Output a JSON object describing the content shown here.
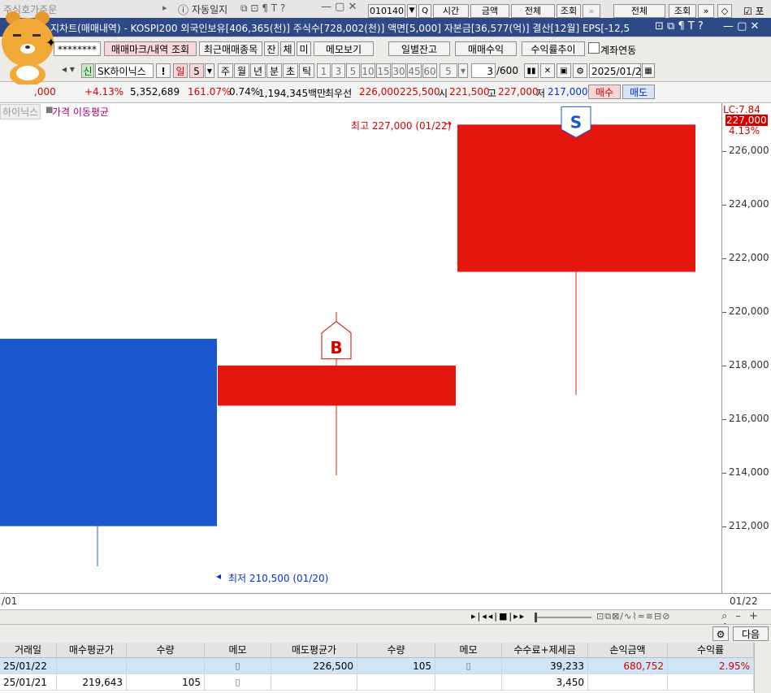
{
  "window": {
    "left_title": "주식호가주문",
    "auto_diary": "자동일지",
    "right_code": "010140",
    "right_opt1": "시간",
    "right_opt2": "금액",
    "right_opt3": "전체",
    "right_query": "조회",
    "right_opt4": "전체",
    "right_query2": "조회",
    "right_check": "포"
  },
  "chart_title": "지차트(매매내역) - KOSPI200 외국인보유[406,365(천)] 주식수[728,002(천)] 액면[5,000] 자본금[36,577(억)] 결산[12월] EPS[-12,5",
  "toolbar1": {
    "password": "********",
    "btn_markings": "매매마크/내역 조회",
    "btn_recent": "최근매매종목",
    "btn_jan": "잔",
    "btn_che": "체",
    "btn_mi": "미",
    "btn_memo": "메모보기",
    "btn_daily": "일별잔고",
    "btn_profit": "매매수익",
    "btn_trend": "수익률추이",
    "chk_account": "계좌연동"
  },
  "toolbar2": {
    "badge": "신",
    "stock_name": "SK하이닉스",
    "excl": "!",
    "period_selected": "일",
    "period_num": "5",
    "periods": [
      "주",
      "월",
      "년",
      "분",
      "초",
      "틱"
    ],
    "nums": [
      "1",
      "3",
      "5",
      "10",
      "15",
      "30",
      "45",
      "60"
    ],
    "num_sel": "5",
    "count": "3",
    "max_count": "/600",
    "date": "2025/01/22"
  },
  "quote": {
    "price": ",000",
    "change_pct": "+4.13%",
    "volume": "5,352,689",
    "vol_ratio": "161.07%",
    "turnover": "0.74%",
    "amount": "1,194,345백만",
    "priority_label": "최우선",
    "ask": "226,000",
    "bid": "225,500",
    "open_label": "시",
    "open": "221,500",
    "high_label": "고",
    "high": "227,000",
    "low_label": "저",
    "low": "217,000",
    "buy_btn": "매수",
    "sell_btn": "매도"
  },
  "legend": {
    "stock": "하이닉스",
    "ma": "가격 이동평균"
  },
  "annotations": {
    "high": "최고 227,000 (01/22)",
    "low": "최저 210,500 (01/20)",
    "sell_mark": "S",
    "buy_mark": "B"
  },
  "yaxis_top": {
    "lc": "LC:7.84",
    "last": "227,000",
    "pct": "4.13%"
  },
  "xaxis": {
    "left": "/01",
    "right": "01/22"
  },
  "tablebar": {
    "next": "다음"
  },
  "table": {
    "headers": [
      "거래일",
      "매수평균가",
      "수량",
      "메모",
      "매도평균가",
      "수량",
      "메모",
      "수수료+제세금",
      "손익금액",
      "수익률"
    ],
    "rows": [
      {
        "date": "25/01/22",
        "buy_avg": "",
        "buy_qty": "",
        "sell_avg": "226,500",
        "sell_qty": "105",
        "fee": "39,233",
        "pnl": "680,752",
        "rate": "2.95%"
      },
      {
        "date": "25/01/21",
        "buy_avg": "219,643",
        "buy_qty": "105",
        "sell_avg": "",
        "sell_qty": "",
        "fee": "3,450",
        "pnl": "",
        "rate": ""
      }
    ]
  },
  "chart_data": {
    "type": "candlestick",
    "ylim": [
      209500,
      227800
    ],
    "y_ticks": [
      212000,
      214000,
      216000,
      218000,
      220000,
      222000,
      224000,
      226000
    ],
    "y_tick_labels": [
      "212,000",
      "214,000",
      "216,000",
      "218,000",
      "220,000",
      "222,000",
      "224,000",
      "226,000"
    ],
    "candles": [
      {
        "date": "01/20",
        "open": 219000,
        "close": 212000,
        "high": 219000,
        "low": 210500,
        "color": "#1a56cc"
      },
      {
        "date": "01/21",
        "open": 216500,
        "close": 218000,
        "high": 220000,
        "low": 213900,
        "color": "#e3170d"
      },
      {
        "date": "01/22",
        "open": 221500,
        "close": 227000,
        "high": 227000,
        "low": 216900,
        "color": "#e3170d"
      }
    ]
  }
}
